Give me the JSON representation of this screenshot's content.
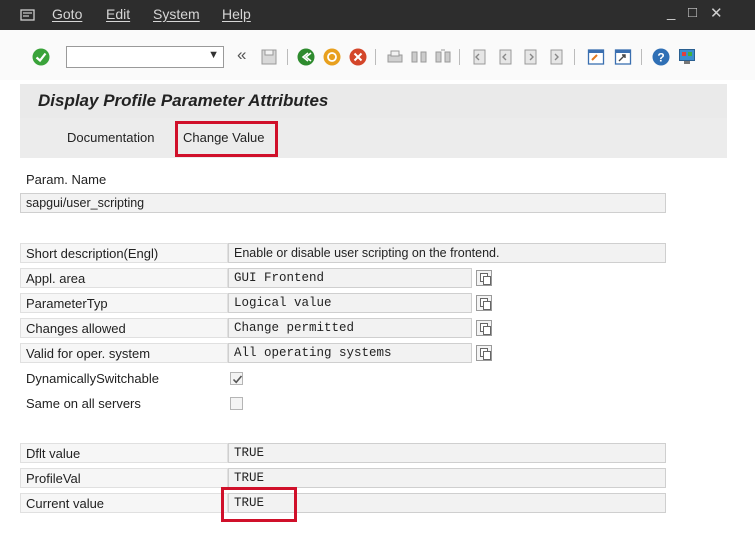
{
  "menu": {
    "items": [
      "Goto",
      "Edit",
      "System",
      "Help"
    ]
  },
  "window_controls": {
    "minimize": "_",
    "maximize": "□",
    "close": "✕"
  },
  "toolbar": {
    "command_field": {
      "value": "",
      "placeholder": ""
    },
    "back_symbol": "«",
    "icons": [
      "enter-icon",
      "save-icon",
      "back-icon",
      "exit-icon",
      "cancel-icon",
      "print-icon",
      "find-icon",
      "find-next-icon",
      "first-page-icon",
      "previous-page-icon",
      "next-page-icon",
      "last-page-icon",
      "create-session-icon",
      "shortcut-icon",
      "help-icon",
      "customize-layout-icon"
    ]
  },
  "page": {
    "title": "Display Profile Parameter Attributes"
  },
  "app_toolbar": {
    "documentation_label": "Documentation",
    "change_value_label": "Change Value"
  },
  "form": {
    "param_name_label": "Param. Name",
    "param_name_value": "sapgui/user_scripting",
    "short_description_label": "Short description(Engl)",
    "short_description_value": "Enable or disable user scripting on the frontend.",
    "appl_area_label": "Appl. area",
    "appl_area_value": "GUI Frontend",
    "parameter_type_label": "ParameterTyp",
    "parameter_type_value": "Logical value",
    "changes_allowed_label": "Changes allowed",
    "changes_allowed_value": "Change permitted",
    "valid_os_label": "Valid for oper. system",
    "valid_os_value": "All operating systems",
    "dynamically_switchable_label": "DynamicallySwitchable",
    "dynamically_switchable_checked": true,
    "same_on_all_servers_label": "Same on all servers",
    "same_on_all_servers_checked": false,
    "dflt_value_label": "Dflt value",
    "dflt_value": "TRUE",
    "profile_val_label": "ProfileVal",
    "profile_val": "TRUE",
    "current_value_label": "Current value",
    "current_value": "TRUE"
  },
  "colors": {
    "highlight": "#d0102a",
    "menu_bar": "#2d2d2d"
  }
}
